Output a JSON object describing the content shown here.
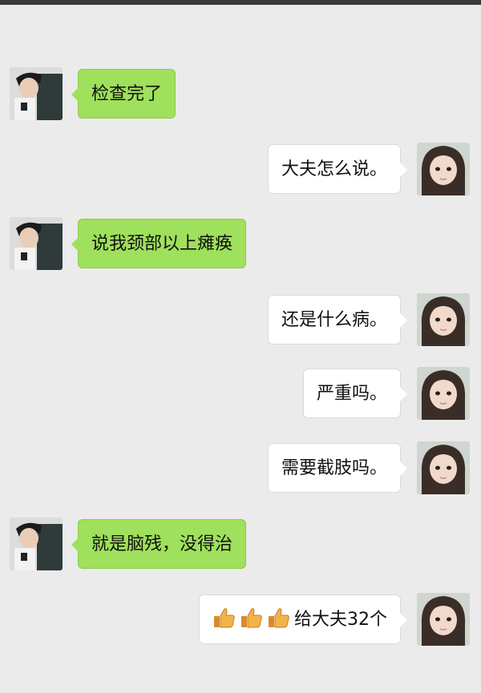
{
  "chat": {
    "messages": [
      {
        "sender": "left",
        "text": "检查完了"
      },
      {
        "sender": "right",
        "text": "大夫怎么说。"
      },
      {
        "sender": "left",
        "text": "说我颈部以上瘫痪"
      },
      {
        "sender": "right",
        "text": "还是什么病。"
      },
      {
        "sender": "right",
        "text": "严重吗。"
      },
      {
        "sender": "right",
        "text": "需要截肢吗。"
      },
      {
        "sender": "left",
        "text": "就是脑残，没得治"
      },
      {
        "sender": "right",
        "text": "给大夫32个",
        "emoji": [
          "thumbs-up-icon",
          "thumbs-up-icon",
          "thumbs-up-icon"
        ]
      }
    ]
  },
  "colors": {
    "background": "#ebebeb",
    "left_bubble": "#9fe05c",
    "right_bubble": "#ffffff"
  }
}
